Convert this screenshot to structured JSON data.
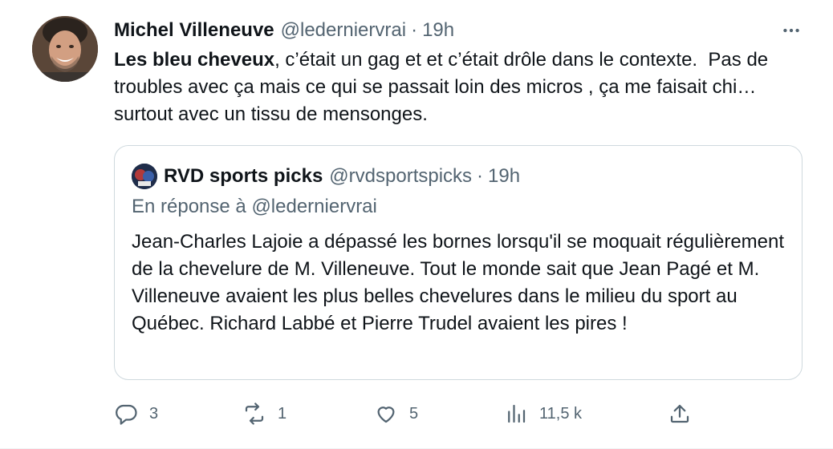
{
  "author": {
    "display_name": "Michel Villeneuve",
    "handle": "@lederniervrai",
    "separator": "·",
    "time": "19h"
  },
  "tweet": {
    "bold": "Les bleu cheveux",
    "text": ", c’était un gag et et c’était drôle dans le contexte.  Pas de troubles avec ça mais ce qui se passait loin des micros , ça me faisait chi… surtout avec un tissu de mensonges."
  },
  "quote": {
    "display_name": "RVD sports picks",
    "handle": "@rvdsportspicks",
    "separator": "·",
    "time": "19h",
    "reply_to": "En réponse à @lederniervrai",
    "text": "Jean-Charles Lajoie a dépassé les bornes lorsqu'il se moquait régulièrement de la chevelure de M. Villeneuve. Tout le monde sait que Jean Pagé et M. Villeneuve avaient les plus belles chevelures dans le milieu du sport au Québec. Richard Labbé et Pierre Trudel avaient les pires !"
  },
  "actions": {
    "replies": "3",
    "reposts": "1",
    "likes": "5",
    "views": "11,5 k"
  },
  "icons": {
    "more": "more-horizontal-icon",
    "reply": "reply-icon",
    "repost": "repost-icon",
    "like": "heart-icon",
    "views": "views-chart-icon",
    "share": "share-icon"
  },
  "colors": {
    "text": "#0f1419",
    "secondary": "#536471",
    "border": "#cfd9de"
  }
}
